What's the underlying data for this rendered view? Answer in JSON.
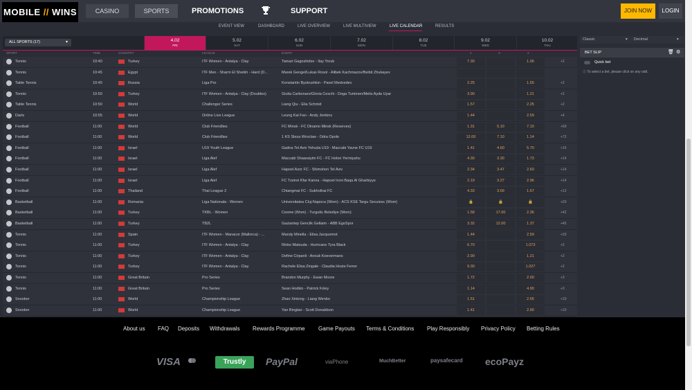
{
  "logo": {
    "text_left": "MOBILE",
    "text_slash": "//",
    "text_right": "WINS"
  },
  "nav": {
    "casino": "CASINO",
    "sports": "SPORTS",
    "promotions": "PROMOTIONS",
    "support": "SUPPORT",
    "join": "JOIN NOW",
    "login": "LOGIN"
  },
  "subnav": [
    "EVENT VIEW",
    "DASHBOARD",
    "LIVE OVERVIEW",
    "LIVE MULTIVIEW",
    "LIVE CALENDAR",
    "RESULTS"
  ],
  "sport_filter": "ALL SPORTS (17)",
  "days": [
    {
      "d": "4.02",
      "w": "FRI"
    },
    {
      "d": "5.02",
      "w": "SAT"
    },
    {
      "d": "6.02",
      "w": "SUN"
    },
    {
      "d": "7.02",
      "w": "MON"
    },
    {
      "d": "8.02",
      "w": "TUE"
    },
    {
      "d": "9.02",
      "w": "WED"
    },
    {
      "d": "10.02",
      "w": "THU"
    }
  ],
  "columns": {
    "sport": "SPORT",
    "time": "TIME",
    "country": "COUNTRY",
    "league": "LEAGUE",
    "event": "EVENT",
    "o1": "1",
    "ox": "X",
    "o2": "2"
  },
  "rows": [
    {
      "sport": "Tennis",
      "time": "10:40",
      "country": "Turkey",
      "league": "ITF Women - Antalya - Clay",
      "event": "Tamari Gagoshidze - Ilay Yoruk",
      "o1": "7.30",
      "ox": "",
      "o2": "1.06",
      "more": "+2"
    },
    {
      "sport": "Tennis",
      "time": "10:45",
      "country": "Egypt",
      "league": "ITF Men - Sharm El Sheikh - Hard (D...",
      "event": "Marek Gengel/Lukas Rosol - Alibek Kachmazov/Beibit Zhukayev",
      "o1": "",
      "ox": "",
      "o2": "",
      "more": ""
    },
    {
      "sport": "Table Tennis",
      "time": "10:45",
      "country": "Russia",
      "league": "Liga Pro",
      "event": "Konstantin Bystrushkin - Pavel Medvedev",
      "o1": "2.25",
      "ox": "",
      "o2": "1.55",
      "more": "+2"
    },
    {
      "sport": "Tennis",
      "time": "10:50",
      "country": "Turkey",
      "league": "ITF Women - Antalya - Clay (Doubles)",
      "event": "Giulia Carbonaro/Gloria Ceschi - Doga Turkmen/Melis Ayda Uyar",
      "o1": "3.90",
      "ox": "",
      "o2": "1.21",
      "more": "+2"
    },
    {
      "sport": "Table Tennis",
      "time": "10:50",
      "country": "World",
      "league": "Challenger Series",
      "event": "Liang Qiu - Elia Schmid",
      "o1": "1.57",
      "ox": "",
      "o2": "2.25",
      "more": "+2"
    },
    {
      "sport": "Darts",
      "time": "10:55",
      "country": "World",
      "league": "Online Live League",
      "event": "Leung Kai Fan - Andy Jenkins",
      "o1": "1.44",
      "ox": "",
      "o2": "2.59",
      "more": "+4"
    },
    {
      "sport": "Football",
      "time": "11:00",
      "country": "World",
      "league": "Club Friendlies",
      "event": "FC Minsk - FC Dinamo Minsk (Reserves)",
      "o1": "1.31",
      "ox": "5.10",
      "o2": "7.10",
      "more": "+69"
    },
    {
      "sport": "Football",
      "time": "11:00",
      "country": "World",
      "league": "Club Friendlies",
      "event": "1 KS Sleza Wroclaw - Odra Opole",
      "o1": "12.00",
      "ox": "7.10",
      "o2": "1.14",
      "more": "+72"
    },
    {
      "sport": "Football",
      "time": "11:00",
      "country": "Israel",
      "league": "U19 Youth League",
      "event": "Gadna Tel Aviv Yehuda U19 - Maccabi Yavne FC U19",
      "o1": "1.41",
      "ox": "4.60",
      "o2": "5.70",
      "more": "+16"
    },
    {
      "sport": "Football",
      "time": "11:00",
      "country": "Israel",
      "league": "Liga Alef",
      "event": "Maccabi Shaaraiyim FC - FC Holon Yermiyahu",
      "o1": "4.30",
      "ox": "3.30",
      "o2": "1.73",
      "more": "+14"
    },
    {
      "sport": "Football",
      "time": "11:00",
      "country": "Israel",
      "league": "Liga Alef",
      "event": "Hapoel Azor FC - Shimshon Tel Aviv",
      "o1": "2.34",
      "ox": "3.47",
      "o2": "2.60",
      "more": "+14"
    },
    {
      "sport": "Football",
      "time": "11:00",
      "country": "Israel",
      "league": "Liga Alef",
      "event": "FC Tzeirei Kfar Kanna - Hapoel Ironi Baqa Al Gharbiyye",
      "o1": "2.19",
      "ox": "3.27",
      "o2": "2.96",
      "more": "+14"
    },
    {
      "sport": "Football",
      "time": "11:00",
      "country": "Thailand",
      "league": "Thai League 2",
      "event": "Chiangmai FC - Sukhothai FC",
      "o1": "4.33",
      "ox": "3.69",
      "o2": "1.67",
      "more": "+12"
    },
    {
      "sport": "Basketball",
      "time": "11:00",
      "country": "Romania",
      "league": "Liga Nationala - Women",
      "event": "Universitatea Cluj-Napoca (Wom) - ACS KSE Targu Secuiesc (Wom)",
      "o1": "🔒",
      "ox": "🔒",
      "o2": "🔒",
      "more": "+20"
    },
    {
      "sport": "Basketball",
      "time": "11:00",
      "country": "Turkey",
      "league": "TKBL - Women",
      "event": "Cesme (Wom) - Turgutlu Belediye (Wom)",
      "o1": "1.58",
      "ox": "17.00",
      "o2": "2.36",
      "more": "+42"
    },
    {
      "sport": "Basketball",
      "time": "11:00",
      "country": "Turkey",
      "league": "TB2L",
      "event": "Gaziantep Genclik Gellaim - ABB EgoSpor",
      "o1": "3.32",
      "ox": "12.00",
      "o2": "1.37",
      "more": "+45"
    },
    {
      "sport": "Tennis",
      "time": "11:00",
      "country": "Spain",
      "league": "ITF Women - Manacor (Mallorca) - ...",
      "event": "Mandy Minella - Elisa Jacquemot",
      "o1": "1.44",
      "ox": "",
      "o2": "2.59",
      "more": "+33"
    },
    {
      "sport": "Tennis",
      "time": "11:00",
      "country": "Turkey",
      "league": "ITF Women - Antalya - Clay",
      "event": "Rinko Matsuda - Hurricane Tyra Black",
      "o1": "6.70",
      "ox": "",
      "o2": "1.073",
      "more": "+2"
    },
    {
      "sport": "Tennis",
      "time": "11:00",
      "country": "Turkey",
      "league": "ITF Women - Antalya - Clay",
      "event": "Define Cirpanli - Anouk Koevermans",
      "o1": "2.90",
      "ox": "",
      "o2": "1.21",
      "more": "+2"
    },
    {
      "sport": "Tennis",
      "time": "11:00",
      "country": "Turkey",
      "league": "ITF Women - Antalya - Clay",
      "event": "Rachele Elisa Zingale - Claudia Hoste Ferrer",
      "o1": "9.30",
      "ox": "",
      "o2": "1.027",
      "more": "+2"
    },
    {
      "sport": "Tennis",
      "time": "11:00",
      "country": "Great Britain",
      "league": "Pro Series",
      "event": "Brandon Murphy - Ewan Moore",
      "o1": "1.72",
      "ox": "",
      "o2": "2.00",
      "more": "+3"
    },
    {
      "sport": "Tennis",
      "time": "11:00",
      "country": "Great Britain",
      "league": "Pro Series",
      "event": "Sean Hodkin - Patrick Foley",
      "o1": "1.14",
      "ox": "",
      "o2": "4.90",
      "more": "+3"
    },
    {
      "sport": "Snooker",
      "time": "11:00",
      "country": "World",
      "league": "Championship League",
      "event": "Zhao Xintong - Liang Wenbo",
      "o1": "1.51",
      "ox": "",
      "o2": "2.55",
      "more": "+10"
    },
    {
      "sport": "Snooker",
      "time": "11:00",
      "country": "World",
      "league": "Championship League",
      "event": "Yan Bingtao - Scott Donaldson",
      "o1": "1.41",
      "ox": "",
      "o2": "2.90",
      "more": "+10"
    }
  ],
  "right_panel": {
    "odds_format_left": "Classic",
    "odds_format_right": "Decimal",
    "bet_slip": "BET SLIP",
    "quick_bet": "Quick bet",
    "hint": "To select a bet, please click on any odd."
  },
  "footer": {
    "links": [
      "About us",
      "FAQ",
      "Deposits",
      "Withdrawals",
      "Rewards Programme",
      "Game Payouts",
      "Terms & Conditions",
      "Play Responsibly",
      "Privacy Policy",
      "Betting Rules"
    ],
    "payments": [
      "VISA",
      "Trustly",
      "PayPal",
      "viaPhone",
      "MuchBetter",
      "paysafecard",
      "ecoPayz"
    ]
  },
  "colors": {
    "accent": "#c2185b",
    "odds": "#e1a35c",
    "join": "#ffb800"
  }
}
